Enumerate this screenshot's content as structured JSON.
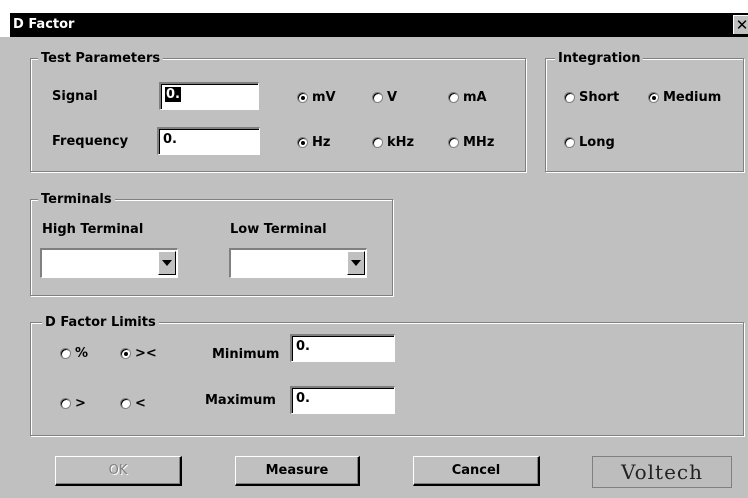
{
  "window": {
    "title": "D Factor",
    "close": "✕"
  },
  "test_parameters": {
    "legend": "Test Parameters",
    "signal_label": "Signal",
    "signal_value": "0.",
    "frequency_label": "Frequency",
    "frequency_value": "0.",
    "signal_units": [
      {
        "label": "mV",
        "selected": true
      },
      {
        "label": "V",
        "selected": false
      },
      {
        "label": "mA",
        "selected": false
      }
    ],
    "frequency_units": [
      {
        "label": "Hz",
        "selected": true
      },
      {
        "label": "kHz",
        "selected": false
      },
      {
        "label": "MHz",
        "selected": false
      }
    ]
  },
  "integration": {
    "legend": "Integration",
    "options": [
      {
        "label": "Short",
        "selected": false
      },
      {
        "label": "Medium",
        "selected": true
      },
      {
        "label": "Long",
        "selected": false
      }
    ]
  },
  "terminals": {
    "legend": "Terminals",
    "high_label": "High Terminal",
    "high_value": "",
    "low_label": "Low Terminal",
    "low_value": ""
  },
  "limits": {
    "legend": "D Factor Limits",
    "mode_options": [
      {
        "label": "%",
        "selected": false
      },
      {
        "label": "><",
        "selected": true
      },
      {
        "label": ">",
        "selected": false
      },
      {
        "label": "<",
        "selected": false
      }
    ],
    "minimum_label": "Minimum",
    "minimum_value": "0.",
    "maximum_label": "Maximum",
    "maximum_value": "0."
  },
  "buttons": {
    "ok": "OK",
    "measure": "Measure",
    "cancel": "Cancel"
  },
  "logo": "Voltech"
}
